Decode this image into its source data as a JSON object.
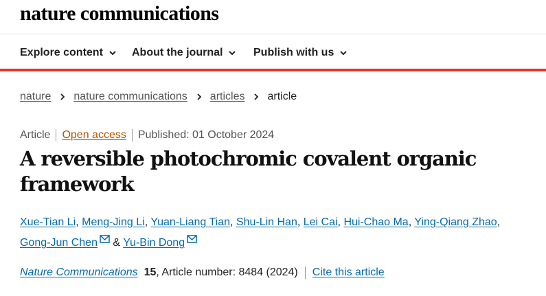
{
  "header": {
    "logo": "nature communications"
  },
  "nav": {
    "items": [
      {
        "label": "Explore content"
      },
      {
        "label": "About the journal"
      },
      {
        "label": "Publish with us"
      }
    ]
  },
  "breadcrumb": {
    "items": [
      "nature",
      "nature communications",
      "articles"
    ],
    "current": "article"
  },
  "meta": {
    "type": "Article",
    "access": "Open access",
    "published": "Published: 01 October 2024"
  },
  "article": {
    "title": "A reversible photochromic covalent organic framework",
    "authors": [
      "Xue-Tian Li",
      "Meng-Jing Li",
      "Yuan-Liang Tian",
      "Shu-Lin Han",
      "Lei Cai",
      "Hui-Chao Ma",
      "Ying-Qiang Zhao",
      "Gong-Jun Chen",
      "Yu-Bin Dong"
    ],
    "author_separator": ", ",
    "author_conjunction": " & "
  },
  "citation": {
    "journal": "Nature Communications",
    "volume": "15",
    "article_number": ", Article number: 8484 (2024)",
    "cite_label": "Cite this article"
  },
  "colors": {
    "accent_red": "#e0352b",
    "link_blue": "#066aa8",
    "open_access_orange": "#b35400"
  },
  "icons": [
    "chevron-down-icon",
    "chevron-right-icon",
    "mail-icon"
  ]
}
